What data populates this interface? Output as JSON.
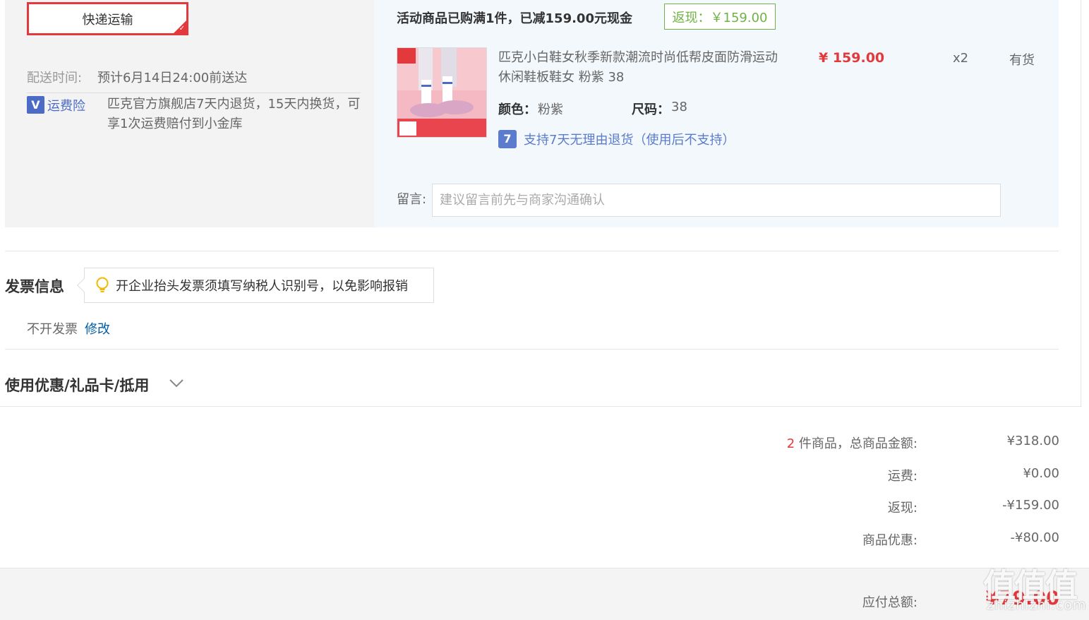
{
  "shipping": {
    "method_label": "快递运输",
    "delivery_label": "配送时间:",
    "delivery_value": "预计6月14日24:00前送达",
    "insurance_badge": "V",
    "insurance_label": "运费险",
    "insurance_desc": "匹克官方旗舰店7天内退货，15天内换货，可享1次运费赔付到小金库"
  },
  "promotion": {
    "text": "活动商品已购满1件，已减159.00元现金",
    "cashback_tag": "返现：￥159.00"
  },
  "product": {
    "title": "匹克小白鞋女秋季新款潮流时尚低帮皮面防滑运动休闲鞋板鞋女 粉紫 38",
    "price": "¥ 159.00",
    "quantity": "x2",
    "stock": "有货",
    "color_key": "颜色：",
    "color_value": "粉紫",
    "size_key": "尺码：",
    "size_value": "38",
    "return_icon": "7",
    "return_text": "支持7天无理由退货（使用后不支持）",
    "image_icon": "shoe-product-image"
  },
  "message": {
    "label": "留言:",
    "placeholder": "建议留言前先与商家沟通确认"
  },
  "invoice": {
    "title": "发票信息",
    "tip": "开企业抬头发票须填写纳税人识别号，以免影响报销",
    "value": "不开发票",
    "edit": "修改"
  },
  "discount": {
    "title": "使用优惠/礼品卡/抵用"
  },
  "summary": {
    "count": "2",
    "count_suffix": "件商品，总商品金额:",
    "goods_total": "¥318.00",
    "freight_label": "运费:",
    "freight_value": "¥0.00",
    "cashback_label": "返现:",
    "cashback_value": "-¥159.00",
    "discount_label": "商品优惠:",
    "discount_value": "-¥80.00",
    "payable_label": "应付总额:",
    "payable_value": "¥79.00"
  },
  "watermark": {
    "main": "值值值",
    "sub": "zhizhizhi.com"
  },
  "colors": {
    "accent_red": "#e4393c",
    "link_blue": "#005ea7",
    "cashback_green": "#71b247",
    "insurance_blue": "#4b6bc7"
  }
}
